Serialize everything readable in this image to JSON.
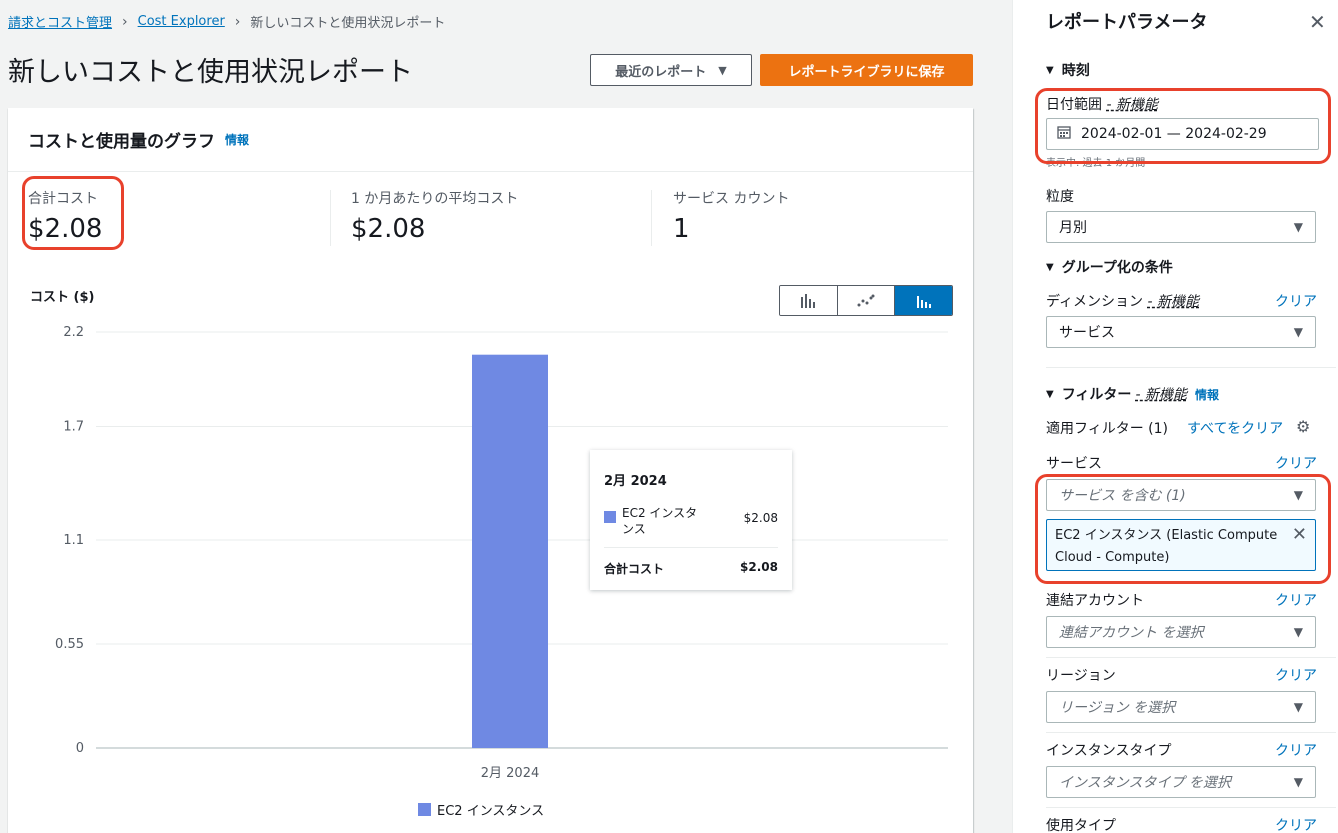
{
  "breadcrumb": {
    "items": [
      "請求とコスト管理",
      "Cost Explorer"
    ],
    "current": "新しいコストと使用状況レポート"
  },
  "page": {
    "title": "新しいコストと使用状況レポート",
    "recent_reports_label": "最近のレポート",
    "save_label": "レポートライブラリに保存"
  },
  "card": {
    "title": "コストと使用量のグラフ",
    "info": "情報",
    "kpis": [
      {
        "label": "合計コスト",
        "value": "$2.08"
      },
      {
        "label": "1 か月あたりの平均コスト",
        "value": "$2.08"
      },
      {
        "label": "サービス カウント",
        "value": "1"
      }
    ]
  },
  "chart_data": {
    "type": "bar",
    "ylabel": "コスト ($)",
    "categories": [
      "2月 2024"
    ],
    "series": [
      {
        "name": "EC2 インスタンス",
        "values": [
          2.08
        ]
      }
    ],
    "y_ticks": [
      "2.2",
      "1.7",
      "1.1",
      "0.55",
      "0"
    ],
    "ylim": [
      0,
      2.2
    ],
    "grid": true,
    "legend": "bottom",
    "color": "#6f89e3",
    "tooltip": {
      "title": "2月 2024",
      "item_name": "EC2 インスタンス",
      "item_value": "$2.08",
      "total_label": "合計コスト",
      "total_value": "$2.08"
    }
  },
  "panel": {
    "title": "レポートパラメータ",
    "time": {
      "heading": "時刻",
      "date_range_label": "日付範囲",
      "new_feature": "- 新機能",
      "date_value": "2024-02-01 — 2024-02-29",
      "date_hint": "表示中: 過去 1 か月間",
      "granularity_label": "粒度",
      "granularity_value": "月別"
    },
    "group": {
      "heading": "グループ化の条件",
      "dimension_label": "ディメンション",
      "new_feature": "- 新機能",
      "clear": "クリア",
      "dimension_value": "サービス"
    },
    "filter": {
      "heading": "フィルター",
      "new_feature": "- 新機能",
      "info": "情報",
      "applied_label": "適用フィルター (1)",
      "clear_all": "すべてをクリア",
      "service_label": "サービス",
      "service_clear": "クリア",
      "service_value": "サービス を含む (1)",
      "token": "EC2 インスタンス (Elastic Compute Cloud - Compute)",
      "linked_label": "連結アカウント",
      "linked_clear": "クリア",
      "linked_placeholder": "連結アカウント を選択",
      "region_label": "リージョン",
      "region_clear": "クリア",
      "region_placeholder": "リージョン を選択",
      "instance_label": "インスタンスタイプ",
      "instance_clear": "クリア",
      "instance_placeholder": "インスタンスタイプ を選択",
      "usage_label": "使用タイプ",
      "usage_clear": "クリア"
    }
  },
  "colors": {
    "accent": "#0073bb",
    "primary_button": "#ec7211",
    "annotation": "#e8412c",
    "series": "#6f89e3"
  }
}
